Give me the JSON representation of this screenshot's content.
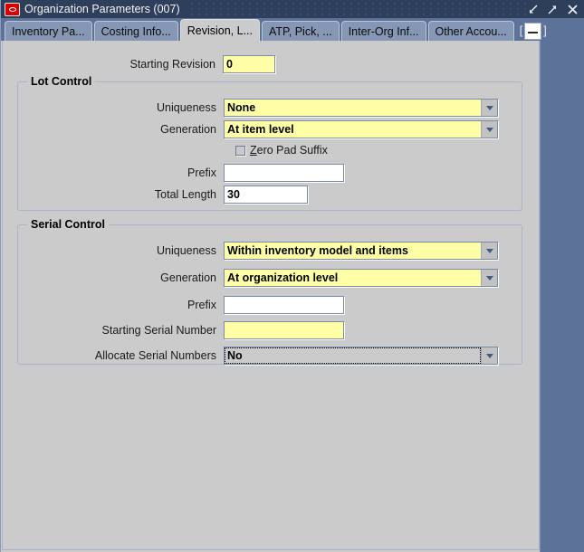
{
  "window": {
    "title": "Organization Parameters (007)",
    "icon": "oracle-oval-icon",
    "controls": {
      "minimize": "minimize-icon",
      "maximize": "maximize-icon",
      "close": "close-icon"
    }
  },
  "tabs": {
    "items": [
      {
        "label": "Inventory Pa...",
        "active": false
      },
      {
        "label": "Costing Info...",
        "active": false
      },
      {
        "label": "Revision, L...",
        "active": true
      },
      {
        "label": "ATP, Pick, ...",
        "active": false
      },
      {
        "label": "Inter-Org Inf...",
        "active": false
      },
      {
        "label": "Other Accou...",
        "active": false
      }
    ],
    "overflow_open": "[",
    "overflow_close": "]",
    "overflow_label": "..."
  },
  "form": {
    "starting_revision": {
      "label": "Starting Revision",
      "value": "0"
    },
    "lot_control": {
      "title": "Lot Control",
      "uniqueness": {
        "label": "Uniqueness",
        "value": "None"
      },
      "generation": {
        "label": "Generation",
        "value": "At item level"
      },
      "zero_pad_suffix": {
        "label_mnemonic": "Z",
        "label_rest": "ero Pad Suffix",
        "checked": false
      },
      "prefix": {
        "label": "Prefix",
        "value": ""
      },
      "total_length": {
        "label": "Total Length",
        "value": "30"
      }
    },
    "serial_control": {
      "title": "Serial Control",
      "uniqueness": {
        "label": "Uniqueness",
        "value": "Within inventory model and items"
      },
      "generation": {
        "label": "Generation",
        "value": "At organization level"
      },
      "prefix": {
        "label": "Prefix",
        "value": ""
      },
      "starting_serial_number": {
        "label": "Starting Serial Number",
        "value": ""
      },
      "allocate_serial_numbers": {
        "label": "Allocate Serial Numbers",
        "value": "No",
        "focused": true
      }
    }
  },
  "colors": {
    "titlebar": "#2e3f5c",
    "desktop": "#5d7299",
    "panel": "#cbcbcb",
    "required_field": "#ffffa8",
    "field_border": "#7b8ca8",
    "tab_inactive": "#8597b4"
  }
}
